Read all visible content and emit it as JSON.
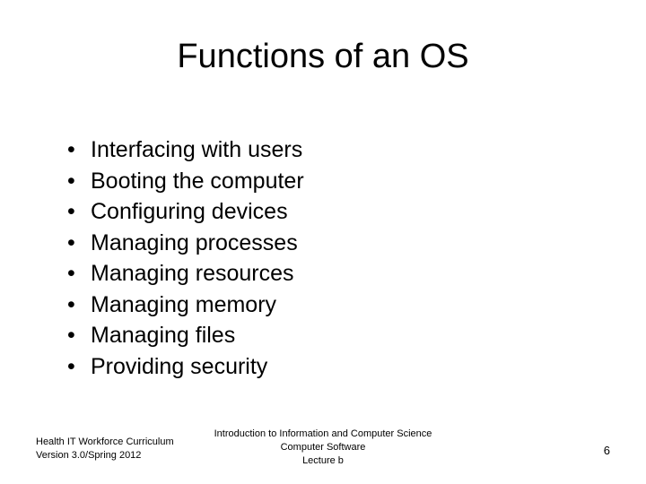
{
  "title": "Functions of an OS",
  "bullets": [
    "Interfacing with users",
    "Booting the computer",
    "Configuring devices",
    "Managing processes",
    "Managing resources",
    "Managing memory",
    "Managing files",
    "Providing security"
  ],
  "footer": {
    "left_line1": "Health IT Workforce Curriculum",
    "left_line2": "Version 3.0/Spring 2012",
    "center_line1": "Introduction to Information and Computer Science",
    "center_line2": "Computer Software",
    "center_line3": "Lecture b",
    "page_number": "6"
  }
}
